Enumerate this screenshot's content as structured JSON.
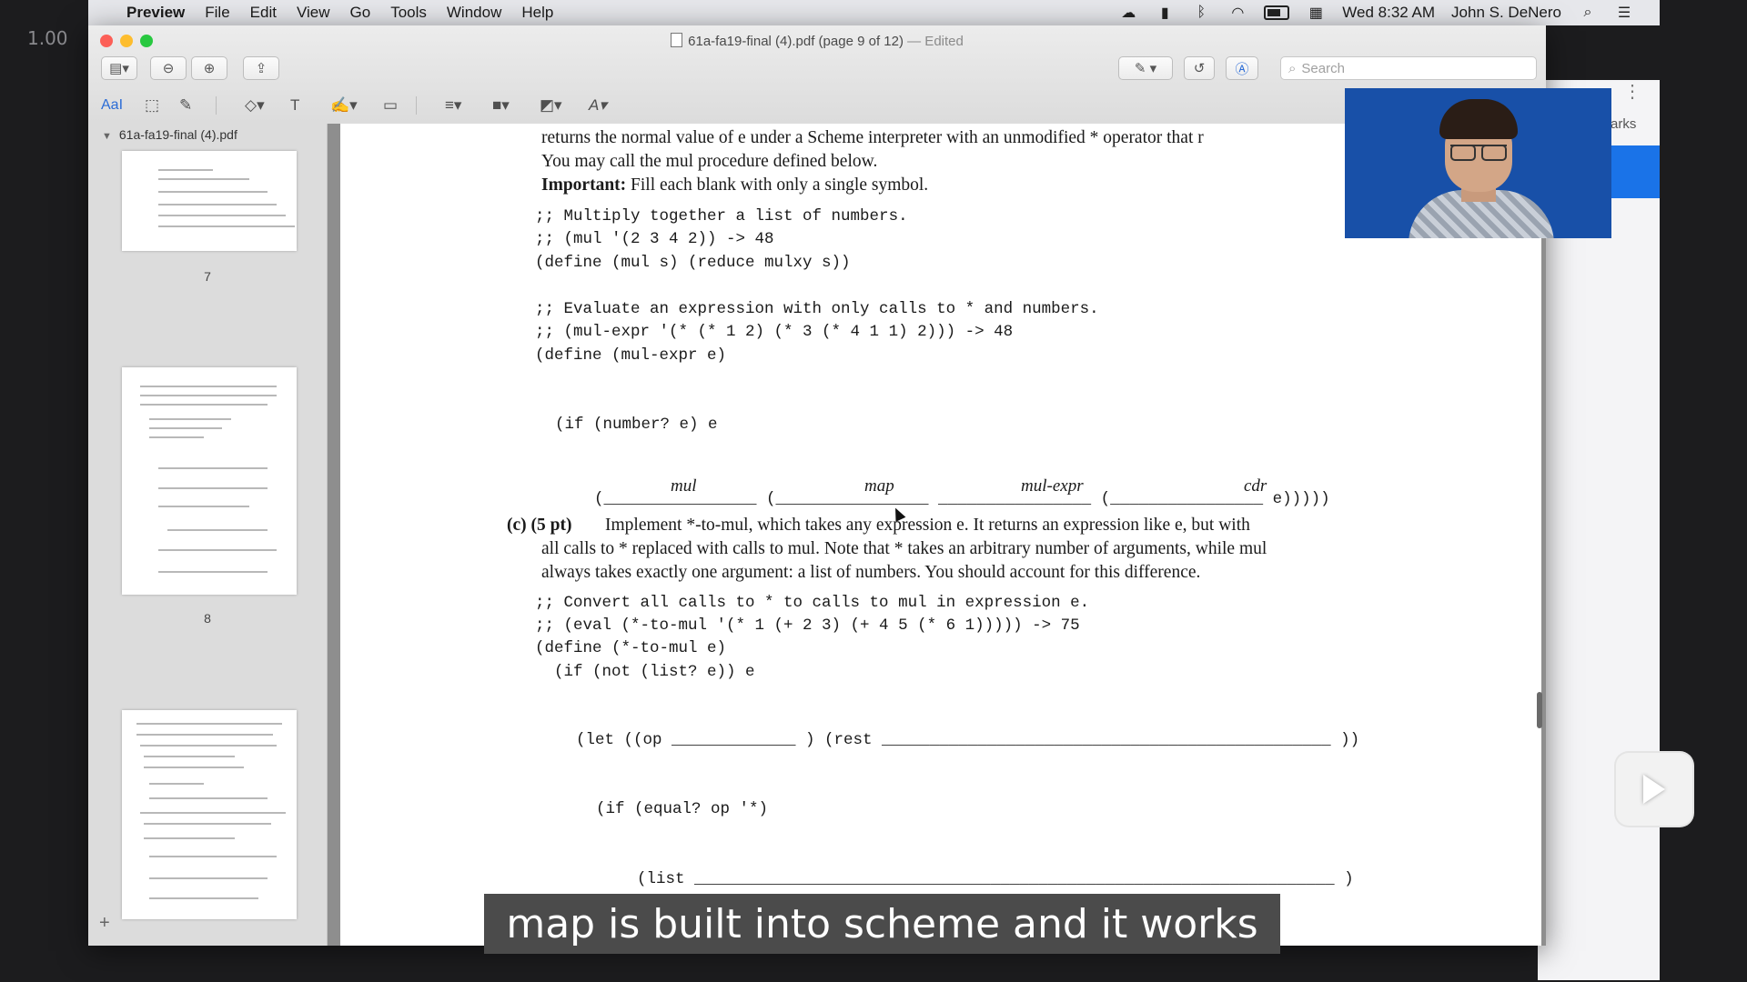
{
  "overlay": {
    "speed": "1.00",
    "subtitle": "map is built into scheme and it works"
  },
  "menubar": {
    "items": [
      "Preview",
      "File",
      "Edit",
      "View",
      "Go",
      "Tools",
      "Window",
      "Help"
    ],
    "clock": "Wed 8:32 AM",
    "user": "John S. DeNero"
  },
  "window": {
    "title": "61a-fa19-final (4).pdf (page 9 of 12)",
    "edited": "— Edited",
    "search_placeholder": "Search",
    "markup_text_tool": "AaI"
  },
  "sidebar": {
    "filename": "61a-fa19-final (4).pdf",
    "page_numbers": [
      "7",
      "8"
    ]
  },
  "background_window": {
    "label": "arks"
  },
  "document": {
    "lines_top": [
      "returns the normal value of e under a Scheme interpreter with an unmodified * operator that r",
      "You may call the mul procedure defined below."
    ],
    "important_label": "Important:",
    "important_text": "Fill each blank with only a single symbol.",
    "code_mul": [
      ";; Multiply together a list of numbers.",
      ";; (mul '(2 3 4 2)) -> 48",
      "(define (mul s) (reduce mulxy s))"
    ],
    "code_mulexpr": [
      ";; Evaluate an expression with only calls to * and numbers.",
      ";; (mul-expr '(* (* 1 2) (* 3 (* 4 1 1) 2))) -> 48",
      "(define (mul-expr e)"
    ],
    "code_if": "(if (number? e) e",
    "blank_line": "(________________ (________________ ________________ (________________ e)))))",
    "handwritten": [
      "mul",
      "map",
      "mul-expr",
      "cdr"
    ],
    "part_c_label": "(c)",
    "part_c_points": "(5 pt)",
    "part_c_lines": [
      "Implement *-to-mul, which takes any expression e. It returns an expression like e, but with",
      "all calls to * replaced with calls to mul. Note that * takes an arbitrary number of arguments, while mul",
      "always takes exactly one argument: a list of numbers. You should account for this difference."
    ],
    "code_tomul": [
      ";; Convert all calls to * to calls to mul in expression e.",
      ";; (eval (*-to-mul '(* 1 (+ 2 3) (+ 4 5 (* 6 1))))) -> 75",
      "(define (*-to-mul e)",
      "  (if (not (list? e)) e"
    ],
    "code_let": "(let ((op _____________ ) (rest _______________________________________________ ))",
    "code_ifequal": "(if (equal? op '*)",
    "code_list": "(list ___________________________________________________________________ )"
  }
}
